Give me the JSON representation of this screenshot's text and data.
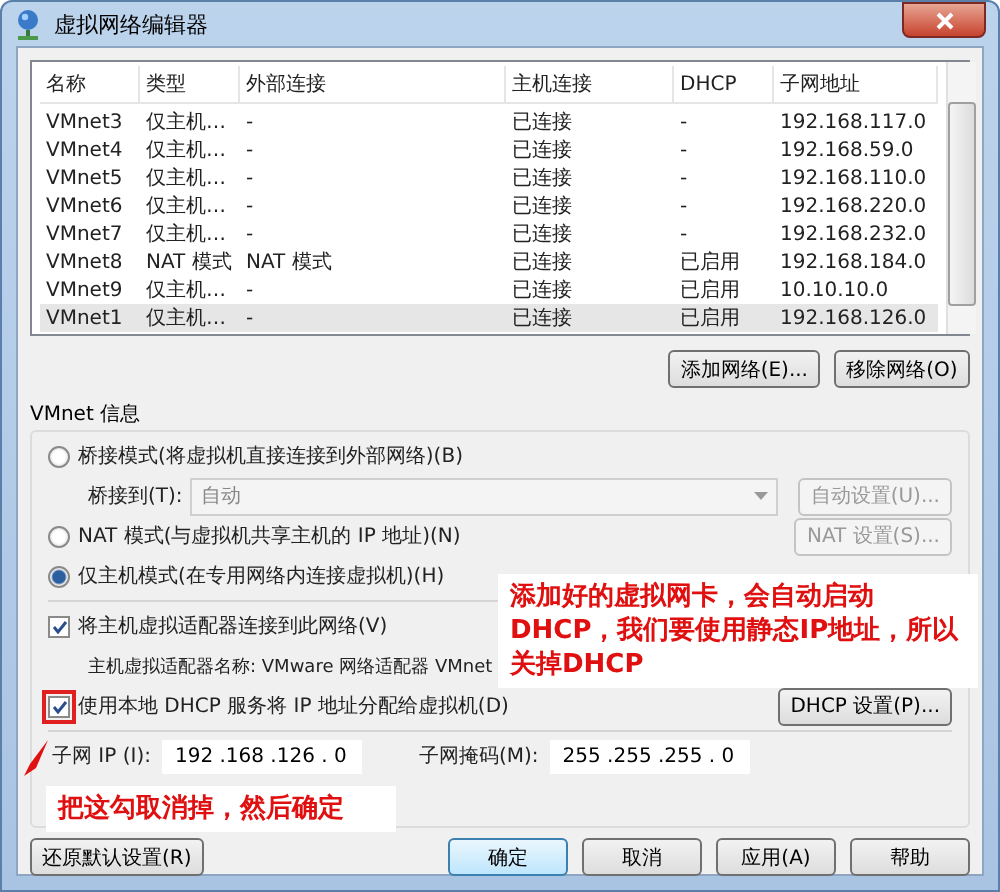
{
  "window": {
    "title": "虚拟网络编辑器"
  },
  "table": {
    "columns": [
      "名称",
      "类型",
      "外部连接",
      "主机连接",
      "DHCP",
      "子网地址"
    ],
    "rows": [
      {
        "cells": [
          "VMnet3",
          "仅主机…",
          "-",
          "已连接",
          "-",
          "192.168.117.0"
        ],
        "selected": false
      },
      {
        "cells": [
          "VMnet4",
          "仅主机…",
          "-",
          "已连接",
          "-",
          "192.168.59.0"
        ],
        "selected": false
      },
      {
        "cells": [
          "VMnet5",
          "仅主机…",
          "-",
          "已连接",
          "-",
          "192.168.110.0"
        ],
        "selected": false
      },
      {
        "cells": [
          "VMnet6",
          "仅主机…",
          "-",
          "已连接",
          "-",
          "192.168.220.0"
        ],
        "selected": false
      },
      {
        "cells": [
          "VMnet7",
          "仅主机…",
          "-",
          "已连接",
          "-",
          "192.168.232.0"
        ],
        "selected": false
      },
      {
        "cells": [
          "VMnet8",
          "NAT 模式",
          "NAT 模式",
          "已连接",
          "已启用",
          "192.168.184.0"
        ],
        "selected": false
      },
      {
        "cells": [
          "VMnet9",
          "仅主机…",
          "-",
          "已连接",
          "已启用",
          "10.10.10.0"
        ],
        "selected": false
      },
      {
        "cells": [
          "VMnet1",
          "仅主机…",
          "-",
          "已连接",
          "已启用",
          "192.168.126.0"
        ],
        "selected": true
      }
    ]
  },
  "table_buttons": [
    "添加网络(E)...",
    "移除网络(O)"
  ],
  "vmnet_info": {
    "title": "VMnet 信息",
    "modes": [
      {
        "label": "桥接模式(将虚拟机直接连接到外部网络)(B)",
        "selected": false,
        "bridge_to": {
          "label": "桥接到(T):",
          "value": "自动",
          "disabled": true,
          "button": "自动设置(U)..."
        }
      },
      {
        "label": "NAT 模式(与虚拟机共享主机的 IP 地址)(N)",
        "selected": false,
        "button": {
          "label": "NAT 设置(S)...",
          "disabled": true
        }
      },
      {
        "label": "仅主机模式(在专用网络内连接虚拟机)(H)",
        "selected": true
      }
    ],
    "host_adapter": {
      "label": "将主机虚拟适配器连接到此网络(V)",
      "checked": true,
      "adapter_name": "主机虚拟适配器名称: VMware 网络适配器 VMnet"
    },
    "dhcp": {
      "label": "使用本地 DHCP 服务将 IP 地址分配给虚拟机(D)",
      "checked": true,
      "highlighted": true,
      "button": "DHCP 设置(P)..."
    },
    "subnet": {
      "ip_label": "子网 IP (I):",
      "ip": "192 .168 .126 . 0",
      "mask_label": "子网掩码(M):",
      "mask": "255 .255 .255 . 0"
    }
  },
  "buttons": [
    {
      "label": "还原默认设置(R)",
      "default": false
    },
    {
      "label": "确定",
      "default": true
    },
    {
      "label": "取消",
      "default": false
    },
    {
      "label": "应用(A)",
      "default": false
    },
    {
      "label": "帮助",
      "default": false
    }
  ],
  "annotations": [
    {
      "text": "添加好的虚拟网卡，会自动启动DHCP，我们要使用静态IP地址，所以关掉DHCP"
    },
    {
      "text": "把这勾取消掉，然后确定"
    }
  ]
}
